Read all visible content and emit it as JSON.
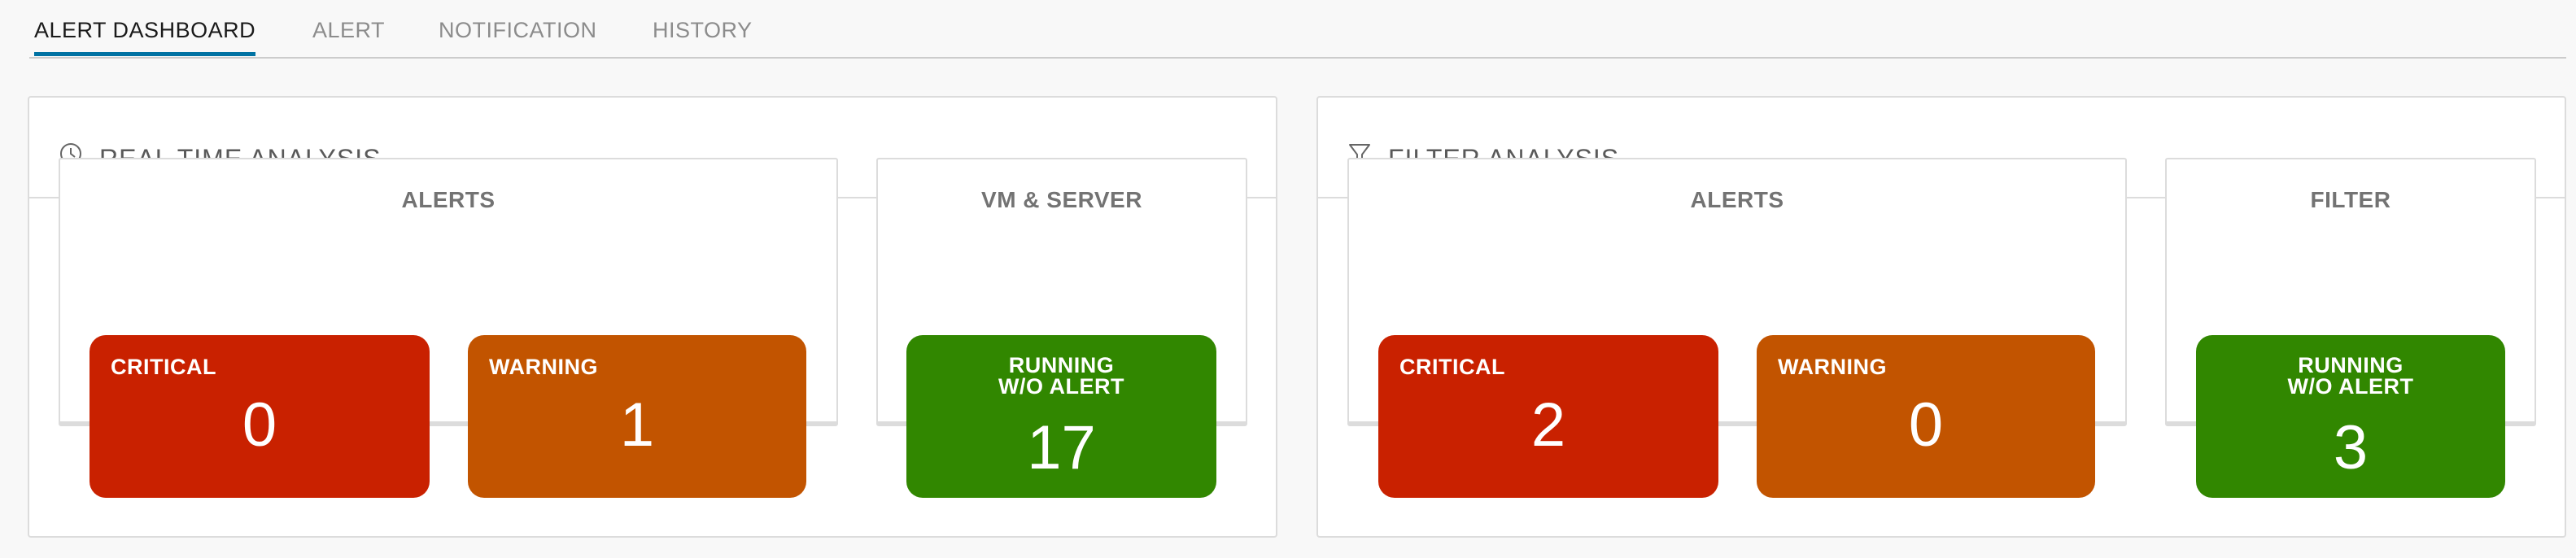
{
  "tabs": [
    {
      "label": "ALERT DASHBOARD",
      "active": true
    },
    {
      "label": "ALERT",
      "active": false
    },
    {
      "label": "NOTIFICATION",
      "active": false
    },
    {
      "label": "HISTORY",
      "active": false
    }
  ],
  "realtime": {
    "title": "REAL TIME ANALYSIS",
    "icon": "clock-icon",
    "alerts_title": "ALERTS",
    "critical_label": "CRITICAL",
    "critical_value": "0",
    "warning_label": "WARNING",
    "warning_value": "1",
    "vm_title": "VM & SERVER",
    "running_label_1": "RUNNING",
    "running_label_2": "W/O ALERT",
    "running_value": "17"
  },
  "filter": {
    "title": "FILTER ANALYSIS",
    "icon": "filter-icon",
    "alerts_title": "ALERTS",
    "critical_label": "CRITICAL",
    "critical_value": "2",
    "warning_label": "WARNING",
    "warning_value": "0",
    "filter_title": "FILTER",
    "running_label_1": "RUNNING",
    "running_label_2": "W/O ALERT",
    "running_value": "3"
  },
  "colors": {
    "critical": "#c92100",
    "warning": "#c25400",
    "running": "#318700",
    "active_tab": "#0072a3"
  }
}
